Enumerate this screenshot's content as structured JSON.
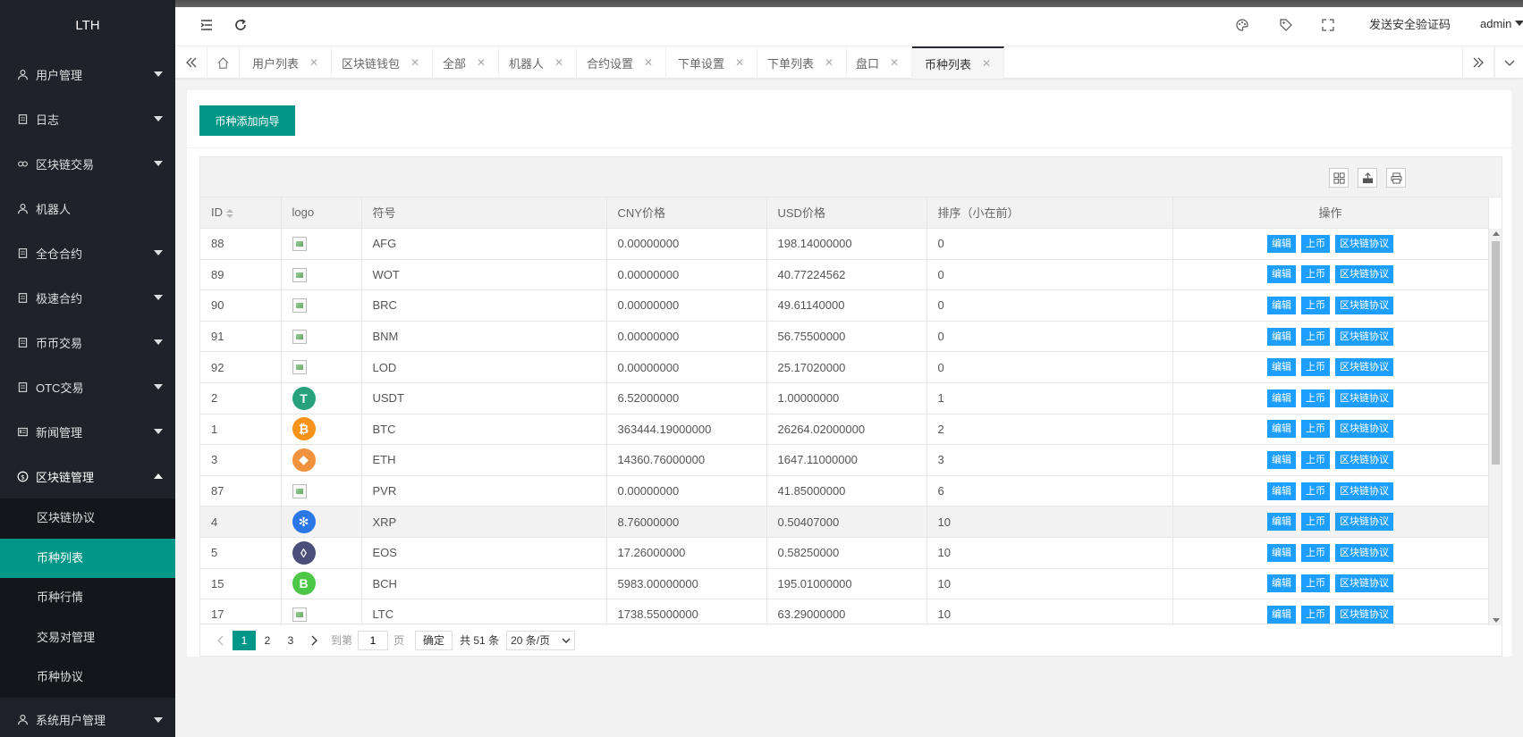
{
  "sidebar": {
    "logo": "LTH",
    "items": [
      {
        "label": "用户管理"
      },
      {
        "label": "日志"
      },
      {
        "label": "区块链交易"
      },
      {
        "label": "机器人"
      },
      {
        "label": "全仓合约"
      },
      {
        "label": "极速合约"
      },
      {
        "label": "币币交易"
      },
      {
        "label": "OTC交易"
      },
      {
        "label": "新闻管理"
      },
      {
        "label": "区块链管理"
      }
    ],
    "sub_items": [
      "区块链协议",
      "币种列表",
      "币种行情",
      "交易对管理",
      "币种协议"
    ],
    "bottom_item": "系统用户管理"
  },
  "header": {
    "send_code": "发送安全验证码",
    "user": "admin"
  },
  "tabs": [
    "用户列表",
    "区块链钱包",
    "全部",
    "机器人",
    "合约设置",
    "下单设置",
    "下单列表",
    "盘口",
    "币种列表"
  ],
  "active_tab": "币种列表",
  "main": {
    "add_button": "币种添加向导",
    "columns": [
      "ID",
      "logo",
      "符号",
      "CNY价格",
      "USD价格",
      "排序（小在前）",
      "操作"
    ],
    "actions": [
      "编辑",
      "上币",
      "区块链协议"
    ],
    "rows": [
      {
        "id": "88",
        "symbol": "AFG",
        "cny": "0.00000000",
        "usd": "198.14000000",
        "sort": "0",
        "logo": "broken"
      },
      {
        "id": "89",
        "symbol": "WOT",
        "cny": "0.00000000",
        "usd": "40.77224562",
        "sort": "0",
        "logo": "broken"
      },
      {
        "id": "90",
        "symbol": "BRC",
        "cny": "0.00000000",
        "usd": "49.61140000",
        "sort": "0",
        "logo": "broken"
      },
      {
        "id": "91",
        "symbol": "BNM",
        "cny": "0.00000000",
        "usd": "56.75500000",
        "sort": "0",
        "logo": "broken"
      },
      {
        "id": "92",
        "symbol": "LOD",
        "cny": "0.00000000",
        "usd": "25.17020000",
        "sort": "0",
        "logo": "broken"
      },
      {
        "id": "2",
        "symbol": "USDT",
        "cny": "6.52000000",
        "usd": "1.00000000",
        "sort": "1",
        "logo": "usdt"
      },
      {
        "id": "1",
        "symbol": "BTC",
        "cny": "363444.19000000",
        "usd": "26264.02000000",
        "sort": "2",
        "logo": "btc"
      },
      {
        "id": "3",
        "symbol": "ETH",
        "cny": "14360.76000000",
        "usd": "1647.11000000",
        "sort": "3",
        "logo": "eth"
      },
      {
        "id": "87",
        "symbol": "PVR",
        "cny": "0.00000000",
        "usd": "41.85000000",
        "sort": "6",
        "logo": "broken"
      },
      {
        "id": "4",
        "symbol": "XRP",
        "cny": "8.76000000",
        "usd": "0.50407000",
        "sort": "10",
        "logo": "xrp"
      },
      {
        "id": "5",
        "symbol": "EOS",
        "cny": "17.26000000",
        "usd": "0.58250000",
        "sort": "10",
        "logo": "eos"
      },
      {
        "id": "15",
        "symbol": "BCH",
        "cny": "5983.00000000",
        "usd": "195.01000000",
        "sort": "10",
        "logo": "bch"
      },
      {
        "id": "17",
        "symbol": "LTC",
        "cny": "1738.55000000",
        "usd": "63.29000000",
        "sort": "10",
        "logo": "broken"
      }
    ],
    "highlight_row_index": 9
  },
  "pager": {
    "pages": [
      "1",
      "2",
      "3"
    ],
    "current": "1",
    "goto_label": "到第",
    "goto_value": "1",
    "page_unit": "页",
    "ok": "确定",
    "total": "共 51 条",
    "per_page": "20 条/页"
  },
  "colors": {
    "accent": "#009688",
    "sidebar_bg": "#20222a",
    "action_blue": "#1E9FFF"
  }
}
